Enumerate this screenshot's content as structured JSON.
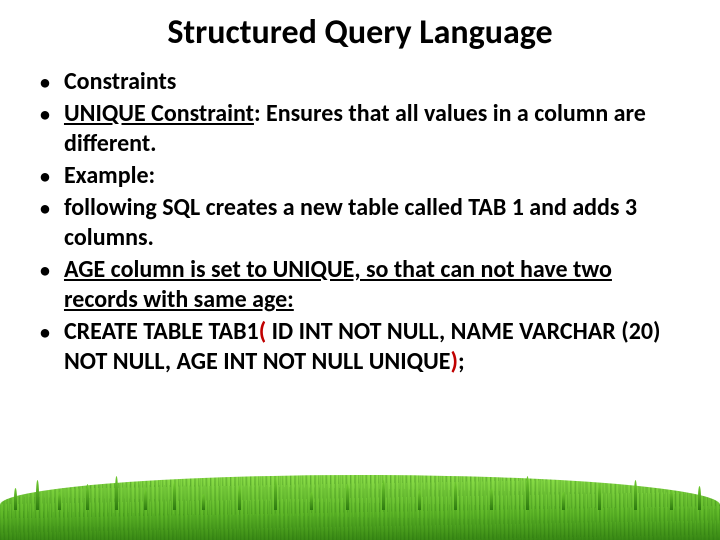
{
  "title": "Structured Query Language",
  "bullets": {
    "b1": "Constraints",
    "b2_underlined": "UNIQUE Constraint",
    "b2_rest": ": Ensures that all values in a column are different.",
    "b3": "Example:",
    "b4": "following SQL creates a new table called TAB 1 and adds 3 columns.",
    "b5_underlined": "AGE column is set to UNIQUE, so that can not have two records with same age:",
    "b6_a": "CREATE TABLE TAB1",
    "b6_b": "(",
    "b6_c": " ID INT NOT NULL, NAME VARCHAR (20) NOT NULL, AGE INT NOT NULL UNIQUE",
    "b6_d": ")",
    "b6_e": ";"
  }
}
